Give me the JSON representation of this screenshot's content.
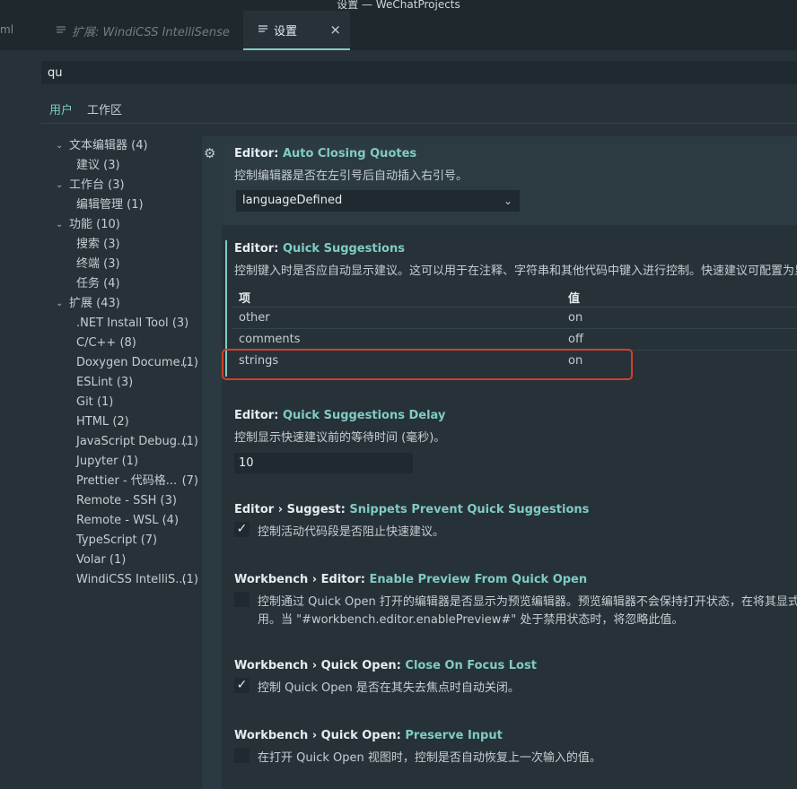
{
  "window": {
    "title": "设置 — WeChatProjects"
  },
  "tabs": {
    "cut_label": "ml",
    "extension_tab": "扩展: WindiCSS IntelliSense",
    "settings_tab": "设置",
    "close_glyph": "×"
  },
  "search": {
    "value": "qu"
  },
  "scopes": {
    "user": "用户",
    "workspace": "工作区"
  },
  "toc": [
    {
      "label": "文本编辑器",
      "count": "(4)"
    },
    {
      "label": "建议",
      "count": "(3)"
    },
    {
      "label": "工作台",
      "count": "(3)"
    },
    {
      "label": "编辑管理",
      "count": "(1)"
    },
    {
      "label": "功能",
      "count": "(10)"
    },
    {
      "label": "搜索",
      "count": "(3)"
    },
    {
      "label": "终端",
      "count": "(3)"
    },
    {
      "label": "任务",
      "count": "(4)"
    },
    {
      "label": "扩展",
      "count": "(43)"
    },
    {
      "label": ".NET Install Tool",
      "count": "(3)"
    },
    {
      "label": "C/C++",
      "count": "(8)"
    },
    {
      "label": "Doxygen Docume...",
      "count": "(1)"
    },
    {
      "label": "ESLint",
      "count": "(3)"
    },
    {
      "label": "Git",
      "count": "(1)"
    },
    {
      "label": "HTML",
      "count": "(2)"
    },
    {
      "label": "JavaScript Debug...",
      "count": "(1)"
    },
    {
      "label": "Jupyter",
      "count": "(1)"
    },
    {
      "label": "Prettier - 代码格...",
      "count": "(7)"
    },
    {
      "label": "Remote - SSH",
      "count": "(3)"
    },
    {
      "label": "Remote - WSL",
      "count": "(4)"
    },
    {
      "label": "TypeScript",
      "count": "(7)"
    },
    {
      "label": "Volar",
      "count": "(1)"
    },
    {
      "label": "WindiCSS IntelliS...",
      "count": "(1)"
    }
  ],
  "settings": {
    "auto_closing_quotes": {
      "category": "Editor: ",
      "key": "Auto Closing Quotes",
      "description": "控制编辑器是否在左引号后自动插入右引号。",
      "value": "languageDefined"
    },
    "quick_suggestions": {
      "category": "Editor: ",
      "key": "Quick Suggestions",
      "description": "控制键入时是否应自动显示建议。这可以用于在注释、字符串和其他代码中键入进行控制。快速建议可配置为显",
      "col_item": "项",
      "col_value": "值",
      "rows": [
        {
          "item": "other",
          "value": "on"
        },
        {
          "item": "comments",
          "value": "off"
        },
        {
          "item": "strings",
          "value": "on"
        }
      ]
    },
    "quick_suggestions_delay": {
      "category": "Editor: ",
      "key": "Quick Suggestions Delay",
      "description": "控制显示快速建议前的等待时间 (毫秒)。",
      "value": "10"
    },
    "snippets_prevent": {
      "category": "Editor › Suggest: ",
      "key": "Snippets Prevent Quick Suggestions",
      "description": "控制活动代码段是否阻止快速建议。",
      "checked": true
    },
    "enable_preview": {
      "category": "Workbench › Editor: ",
      "key": "Enable Preview From Quick Open",
      "description_line1": "控制通过 Quick Open 打开的编辑器是否显示为预览编辑器。预览编辑器不会保持打开状态，在将其显式设",
      "description_line2": "用。当 \"#workbench.editor.enablePreview#\" 处于禁用状态时，将忽略此值。",
      "checked": false
    },
    "close_on_focus_lost": {
      "category": "Workbench › Quick Open: ",
      "key": "Close On Focus Lost",
      "description": "控制 Quick Open 是否在其失去焦点时自动关闭。",
      "checked": true
    },
    "preserve_input": {
      "category": "Workbench › Quick Open: ",
      "key": "Preserve Input",
      "description": "在打开 Quick Open 视图时，控制是否自动恢复上一次输入的值。",
      "checked": false
    }
  },
  "icons": {
    "gear": "gear-icon",
    "chevron": "chevron-down-icon",
    "check": "check-icon",
    "close": "close-icon",
    "settings_file": "file-lines-icon"
  },
  "colors": {
    "accent": "#80cbc4",
    "highlight_box": "#d1402d",
    "background": "#263238"
  }
}
